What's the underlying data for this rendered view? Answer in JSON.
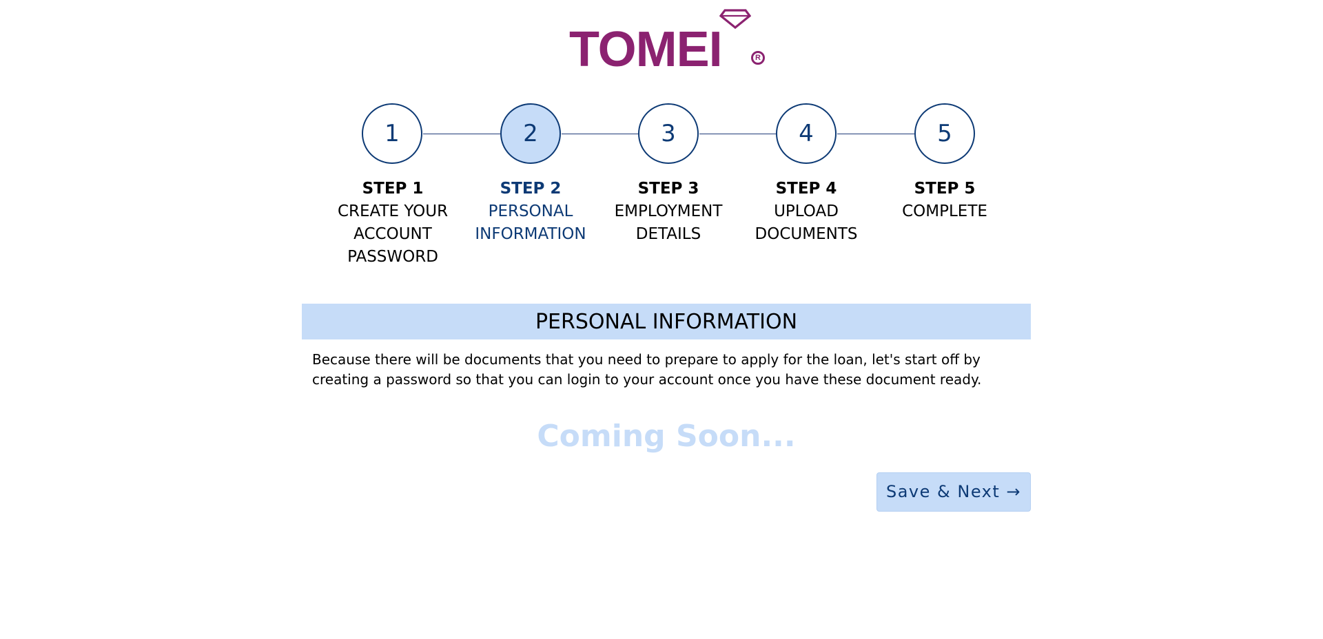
{
  "brand": {
    "name": "TOMEI",
    "registered_mark": "R",
    "color": "#8b2270",
    "gem_icon": "diamond-icon"
  },
  "stepper": {
    "active_step": 2,
    "steps": [
      {
        "number": "1",
        "title": "STEP 1",
        "name": "CREATE YOUR ACCOUNT PASSWORD"
      },
      {
        "number": "2",
        "title": "STEP 2",
        "name": "PERSONAL INFORMATION"
      },
      {
        "number": "3",
        "title": "STEP 3",
        "name": "EMPLOYMENT DETAILS"
      },
      {
        "number": "4",
        "title": "STEP 4",
        "name": "UPLOAD DOCUMENTS"
      },
      {
        "number": "5",
        "title": "STEP 5",
        "name": "COMPLETE"
      }
    ]
  },
  "section": {
    "title": "PERSONAL INFORMATION",
    "description": "Because there will be documents that you need to prepare to apply for the loan, let's start off by creating a password so that you can login to your account once you have these document ready.",
    "placeholder": "Coming Soon..."
  },
  "actions": {
    "save_next_label": "Save & Next →"
  },
  "colors": {
    "accent": "#0d3a75",
    "highlight": "#c6dcf8",
    "text": "#000000"
  }
}
